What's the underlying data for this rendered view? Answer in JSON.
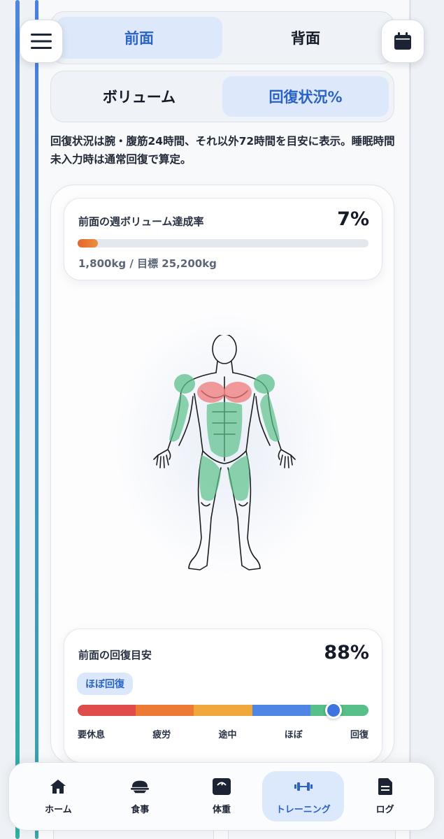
{
  "view_toggle": {
    "options": [
      "前面",
      "背面"
    ],
    "selected": "前面"
  },
  "mode_toggle": {
    "options": [
      "ボリューム",
      "回復状況%"
    ],
    "selected": "回復状況%"
  },
  "note": "回復状況は腕・腹筋24時間、それ以外72時間を目安に表示。睡眠時間未入力時は通常回復で算定。",
  "volume_card": {
    "title": "前面の週ボリューム達成率",
    "percent_text": "7%",
    "progress": 0.07,
    "subtitle": "1,800kg / 目標 25,200kg",
    "progress_color": "#e8722f"
  },
  "recovery_card": {
    "title": "前面の回復目安",
    "percent_text": "88%",
    "progress": 0.88,
    "badge": "ほぼ回復",
    "segments": [
      "#e04b4b",
      "#ec7a35",
      "#f0a83c",
      "#4f86e6",
      "#58bf8a"
    ],
    "labels": [
      "要休息",
      "疲労",
      "途中",
      "ほぼ",
      "回復"
    ]
  },
  "muscle_colors": {
    "recovered": "#5cc08c",
    "fatigued": "#ef7a7a"
  },
  "nav": {
    "items": [
      {
        "label": "ホーム",
        "icon": "home-icon"
      },
      {
        "label": "食事",
        "icon": "meal-icon"
      },
      {
        "label": "体重",
        "icon": "scale-icon"
      },
      {
        "label": "トレーニング",
        "icon": "dumbbell-icon"
      },
      {
        "label": "ログ",
        "icon": "document-icon"
      }
    ],
    "active": "トレーニング"
  }
}
